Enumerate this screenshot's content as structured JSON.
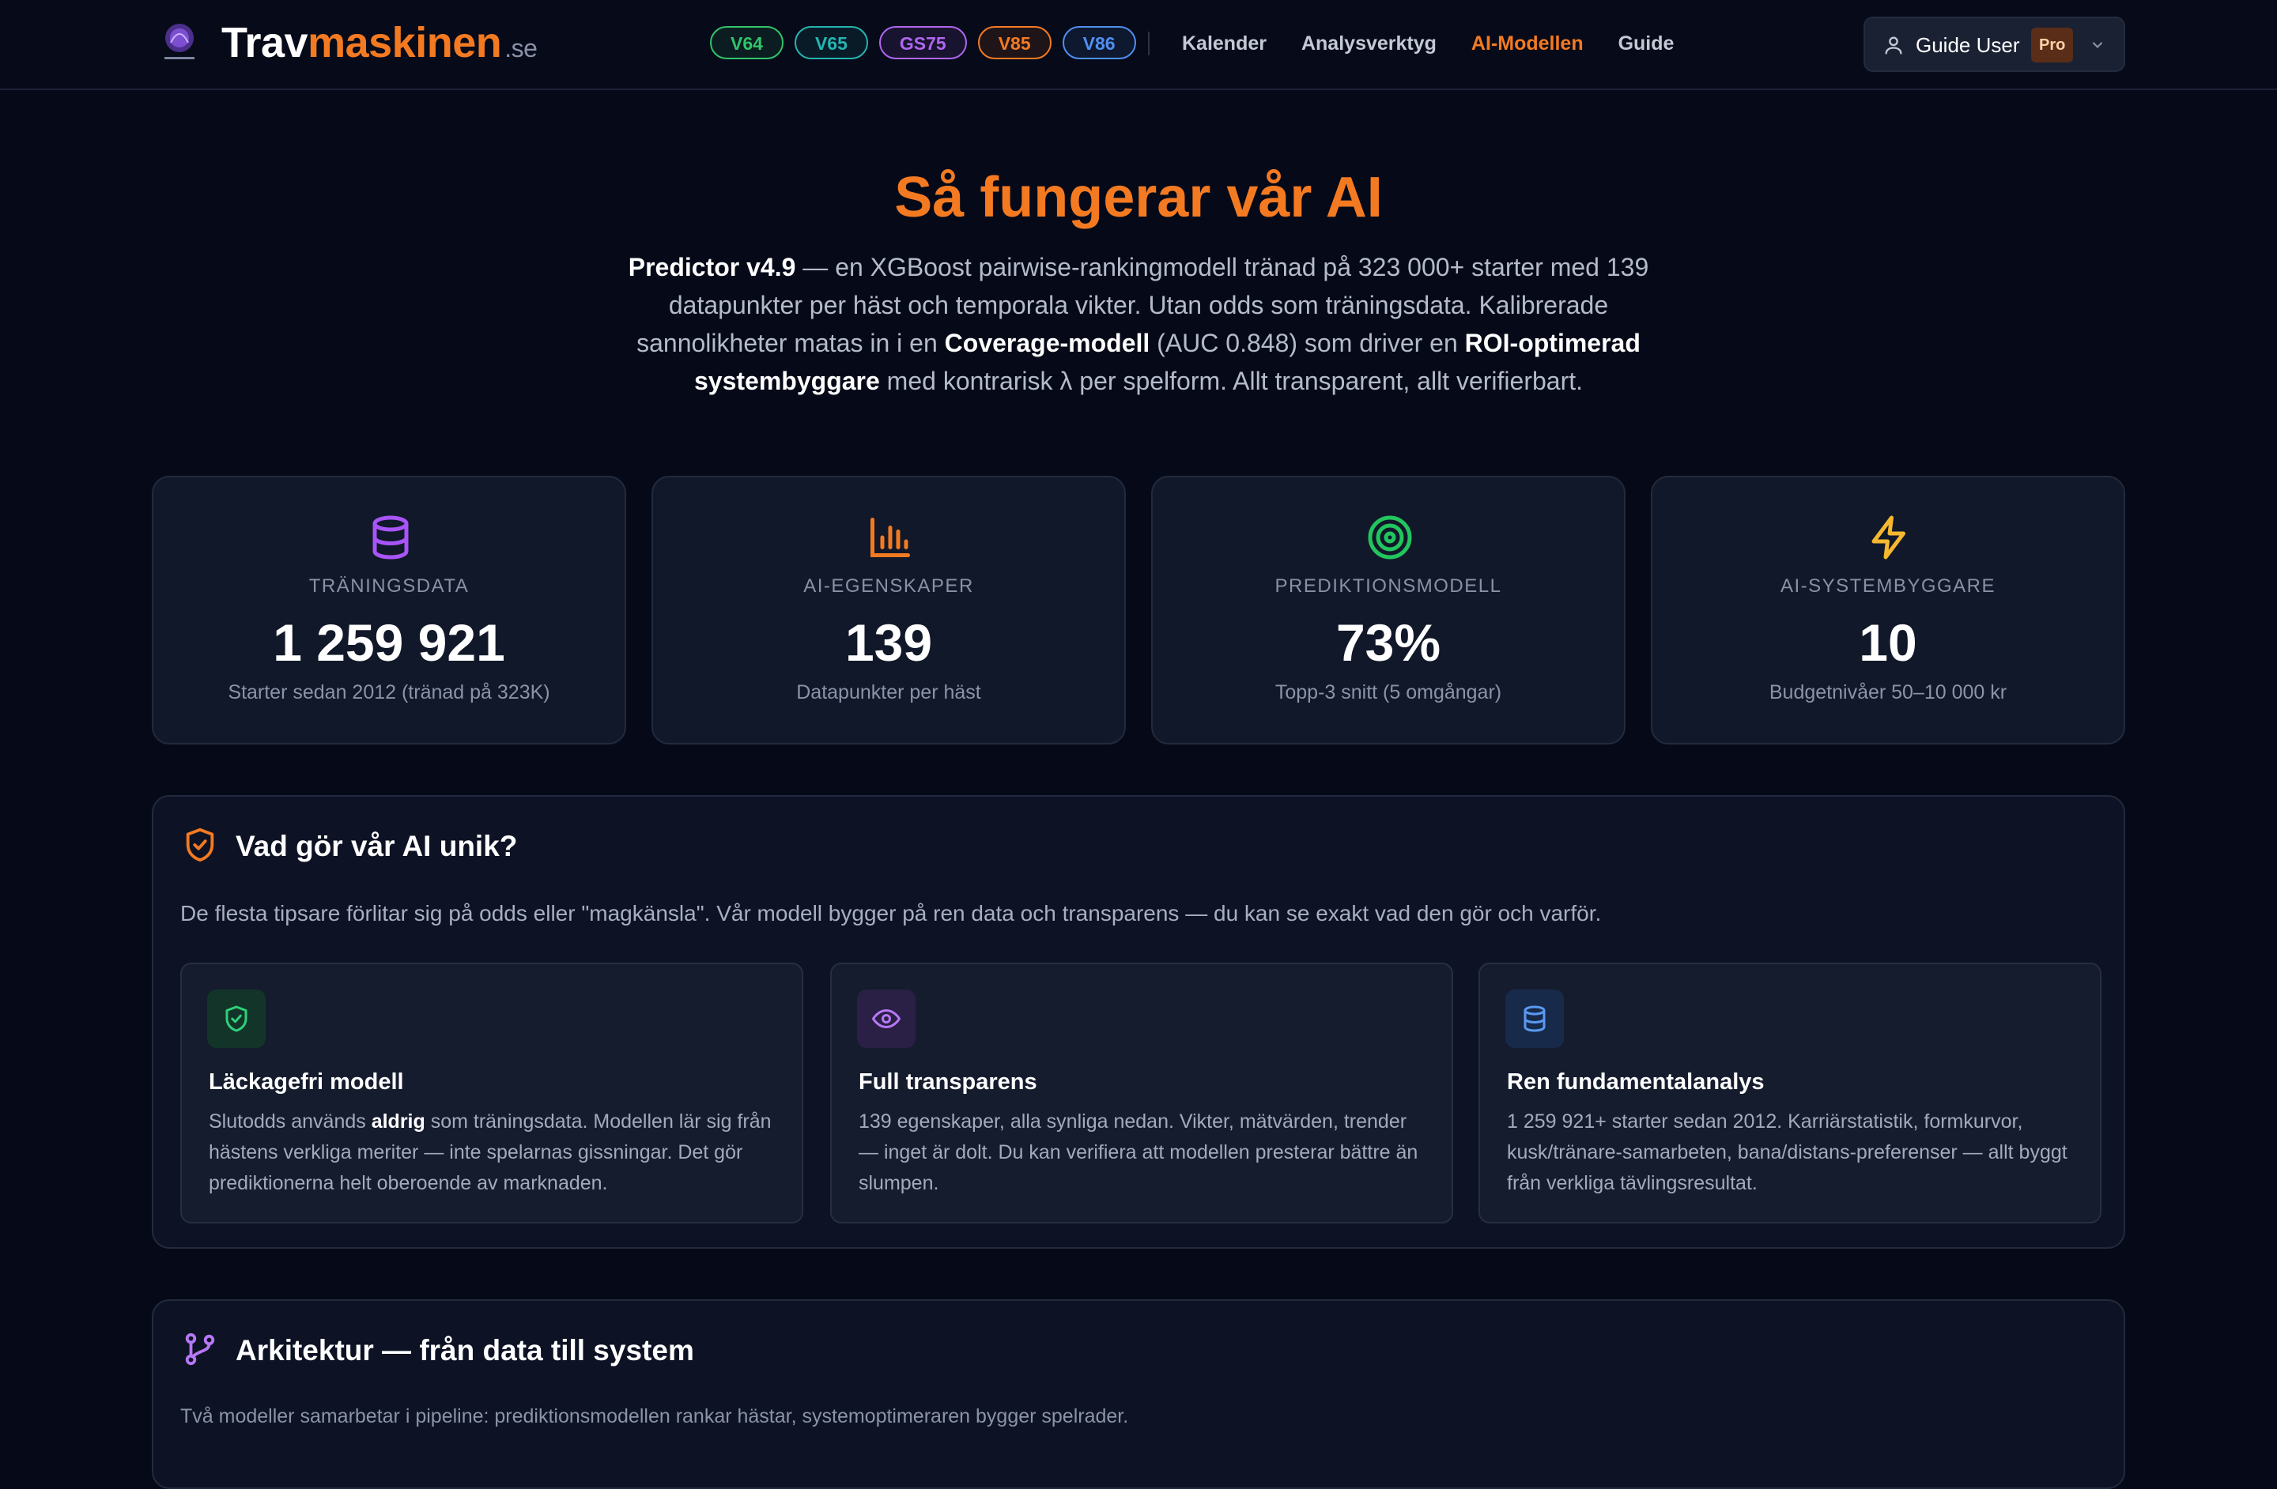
{
  "header": {
    "brand_part1": "Trav",
    "brand_part2": "maskinen",
    "brand_tld": ".se",
    "game_pills": [
      {
        "label": "V64",
        "color": "#31c46a"
      },
      {
        "label": "V65",
        "color": "#25b4b0"
      },
      {
        "label": "GS75",
        "color": "#b066f0"
      },
      {
        "label": "V85",
        "color": "#f47a22"
      },
      {
        "label": "V86",
        "color": "#4f8ff0"
      }
    ],
    "nav": [
      {
        "label": "Kalender"
      },
      {
        "label": "Analysverktyg"
      },
      {
        "label": "AI-Modellen"
      },
      {
        "label": "Guide"
      }
    ],
    "active_nav": "AI-Modellen",
    "user": {
      "name": "Guide User",
      "badge": "Pro"
    }
  },
  "hero": {
    "title": "Så fungerar vår AI",
    "desc_b1": "Predictor v4.9",
    "desc_t1": " — en XGBoost pairwise-rankingmodell tränad på 323 000+ starter med 139 datapunkter per häst och temporala vikter. Utan odds som träningsdata. Kalibrerade sannolikheter matas in i en ",
    "desc_b2": "Coverage-modell",
    "desc_t2": " (AUC 0.848) som driver en ",
    "desc_b3": "ROI-optimerad systembyggare",
    "desc_t3": " med kontrarisk λ per spelform. Allt transparent, allt verifierbart."
  },
  "stats": [
    {
      "icon": "database-icon",
      "color": "#a855f7",
      "label": "TRÄNINGSDATA",
      "value": "1 259 921",
      "sub": "Starter sedan 2012 (tränad på 323K)"
    },
    {
      "icon": "bar-chart-icon",
      "color": "#f47a22",
      "label": "AI-EGENSKAPER",
      "value": "139",
      "sub": "Datapunkter per häst"
    },
    {
      "icon": "target-icon",
      "color": "#22c55e",
      "label": "PREDIKTIONSMODELL",
      "value": "73%",
      "sub": "Topp-3 snitt (5 omgångar)"
    },
    {
      "icon": "lightning-icon",
      "color": "#f5b82e",
      "label": "AI-SYSTEMBYGGARE",
      "value": "10",
      "sub": "Budgetnivåer 50–10 000 kr"
    }
  ],
  "unique": {
    "title": "Vad gör vår AI unik?",
    "desc": "De flesta tipsare förlitar sig på odds eller \"magkänsla\". Vår modell bygger på ren data och transparens — du kan se exakt vad den gör och varför.",
    "features": [
      {
        "icon": "shield-check-icon",
        "title": "Läckagefri modell",
        "t1": "Slutodds används ",
        "b1": "aldrig",
        "t2": " som träningsdata. Modellen lär sig från hästens verkliga meriter — inte spelarnas gissningar. Det gör prediktionerna helt oberoende av marknaden."
      },
      {
        "icon": "eye-icon",
        "title": "Full transparens",
        "t1": "139 egenskaper, alla synliga nedan. Vikter, mätvärden, trender — inget är dolt. Du kan verifiera att modellen presterar bättre än slumpen.",
        "b1": "",
        "t2": ""
      },
      {
        "icon": "database-icon",
        "title": "Ren fundamentalanalys",
        "t1": "1 259 921+ starter sedan 2012. Karriärstatistik, formkurvor, kusk/tränare-samarbeten, bana/distans-preferenser — allt byggt från verkliga tävlingsresultat.",
        "b1": "",
        "t2": ""
      }
    ]
  },
  "architecture": {
    "title": "Arkitektur — från data till system",
    "desc": "Två modeller samarbetar i pipeline: prediktionsmodellen rankar hästar, systemoptimeraren bygger spelrader."
  }
}
